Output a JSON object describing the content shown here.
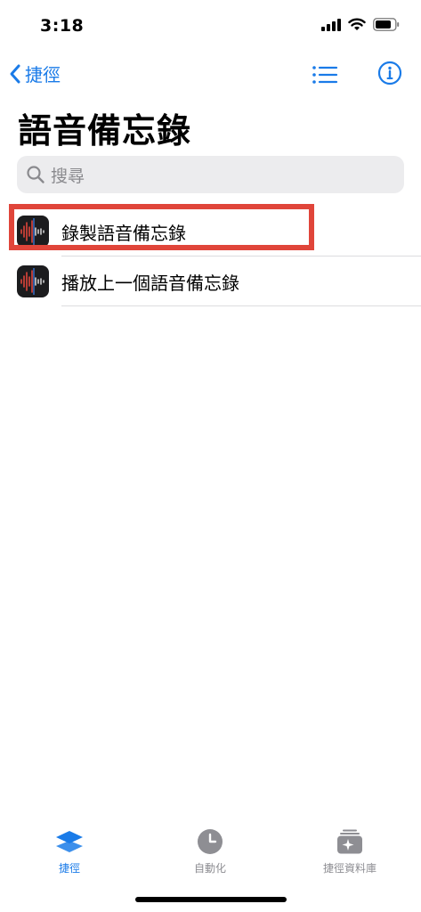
{
  "status_bar": {
    "time": "3:18"
  },
  "nav": {
    "back_label": "捷徑",
    "back_icon": "chevron-left-icon",
    "list_icon": "list-icon",
    "info_icon": "info-circle-icon"
  },
  "page": {
    "title": "語音備忘錄"
  },
  "search": {
    "placeholder": "搜尋",
    "icon": "search-icon"
  },
  "actions": [
    {
      "label": "錄製語音備忘錄",
      "icon": "voice-memos-icon"
    },
    {
      "label": "播放上一個語音備忘錄",
      "icon": "voice-memos-icon"
    }
  ],
  "tab_bar": {
    "tabs": [
      {
        "label": "捷徑",
        "icon": "layers-icon",
        "active": true
      },
      {
        "label": "自動化",
        "icon": "clock-icon",
        "active": false
      },
      {
        "label": "捷徑資料庫",
        "icon": "gallery-icon",
        "active": false
      }
    ]
  },
  "colors": {
    "accent": "#1a7be8",
    "highlight": "#e0453a",
    "inactive": "#8e8e93"
  }
}
